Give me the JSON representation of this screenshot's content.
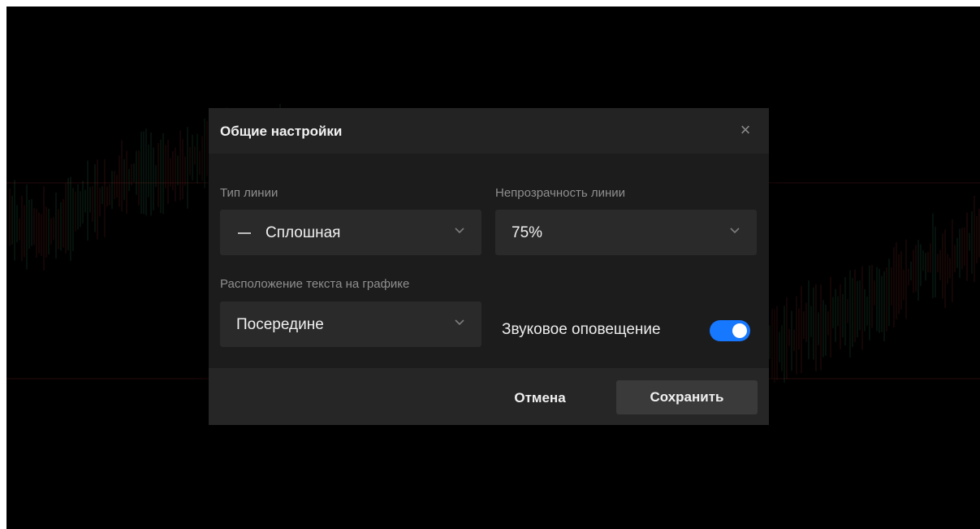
{
  "dialog": {
    "title": "Общие настройки",
    "close_symbol": "×",
    "line_type": {
      "label": "Тип линии",
      "value": "Сплошная"
    },
    "line_opacity": {
      "label": "Непрозрачность линии",
      "value": "75%"
    },
    "text_position": {
      "label": "Расположение текста на графике",
      "value": "Посередине"
    },
    "sound_alert": {
      "label": "Звуковое оповещение",
      "enabled": true
    },
    "cancel_label": "Отмена",
    "save_label": "Сохранить"
  },
  "colors": {
    "toggle_on": "#1677ff",
    "dialog_bg": "#1c1c1c",
    "select_bg": "#2a2a2a",
    "candle_up": "#2e7d4f",
    "candle_down": "#8c2a2a",
    "crosshair": "#6b2222"
  },
  "icons": {
    "close": "close-icon",
    "chevron": "chevron-down-icon",
    "line_style": "solid-line-icon"
  }
}
